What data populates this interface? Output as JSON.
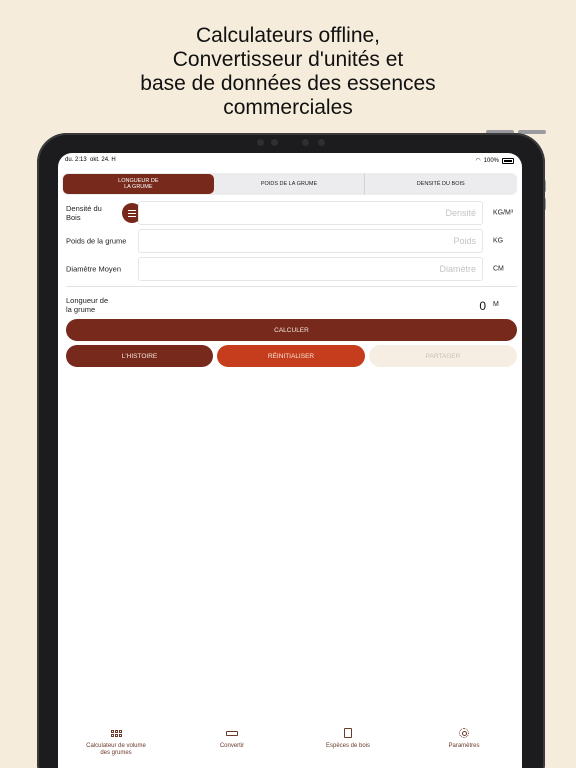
{
  "headline": [
    "Calculateurs offline,",
    "Convertisseur d'unités et",
    "base de données des essences",
    "commerciales"
  ],
  "status": {
    "time": "du. 2:13",
    "date": "okt. 24. H",
    "battery": "100%"
  },
  "segments": [
    {
      "label": "LONGUEUR DE LA GRUME",
      "active": true
    },
    {
      "label": "POIDS DE LA GRUME",
      "active": false
    },
    {
      "label": "DENSITÉ DU BOIS",
      "active": false
    }
  ],
  "form": {
    "density": {
      "label": "Densité du Bois",
      "placeholder": "Densité",
      "unit": "KG/M³"
    },
    "weight": {
      "label": "Poids de la grume",
      "placeholder": "Poids",
      "unit": "KG"
    },
    "diameter": {
      "label": "Diamètre Moyen",
      "placeholder": "Diamètre",
      "unit": "CM"
    }
  },
  "result": {
    "label": "Longueur de la grume",
    "value": "0",
    "unit": "M"
  },
  "buttons": {
    "calculate": "CALCULER",
    "history": "L'HISTOIRE",
    "reset": "RÉINITIALISER",
    "share": "PARTAGER"
  },
  "tabs": [
    {
      "label": "Calculateur de volume des grumes",
      "icon": "grid-icon"
    },
    {
      "label": "Convertir",
      "icon": "ruler-icon"
    },
    {
      "label": "Espèces de bois",
      "icon": "book-icon"
    },
    {
      "label": "Paramètres",
      "icon": "gear-icon"
    }
  ],
  "colors": {
    "primary": "#772a1c",
    "reset": "#c63d1d",
    "background": "#f5ecdb",
    "share_disabled": "#f7eee3"
  }
}
